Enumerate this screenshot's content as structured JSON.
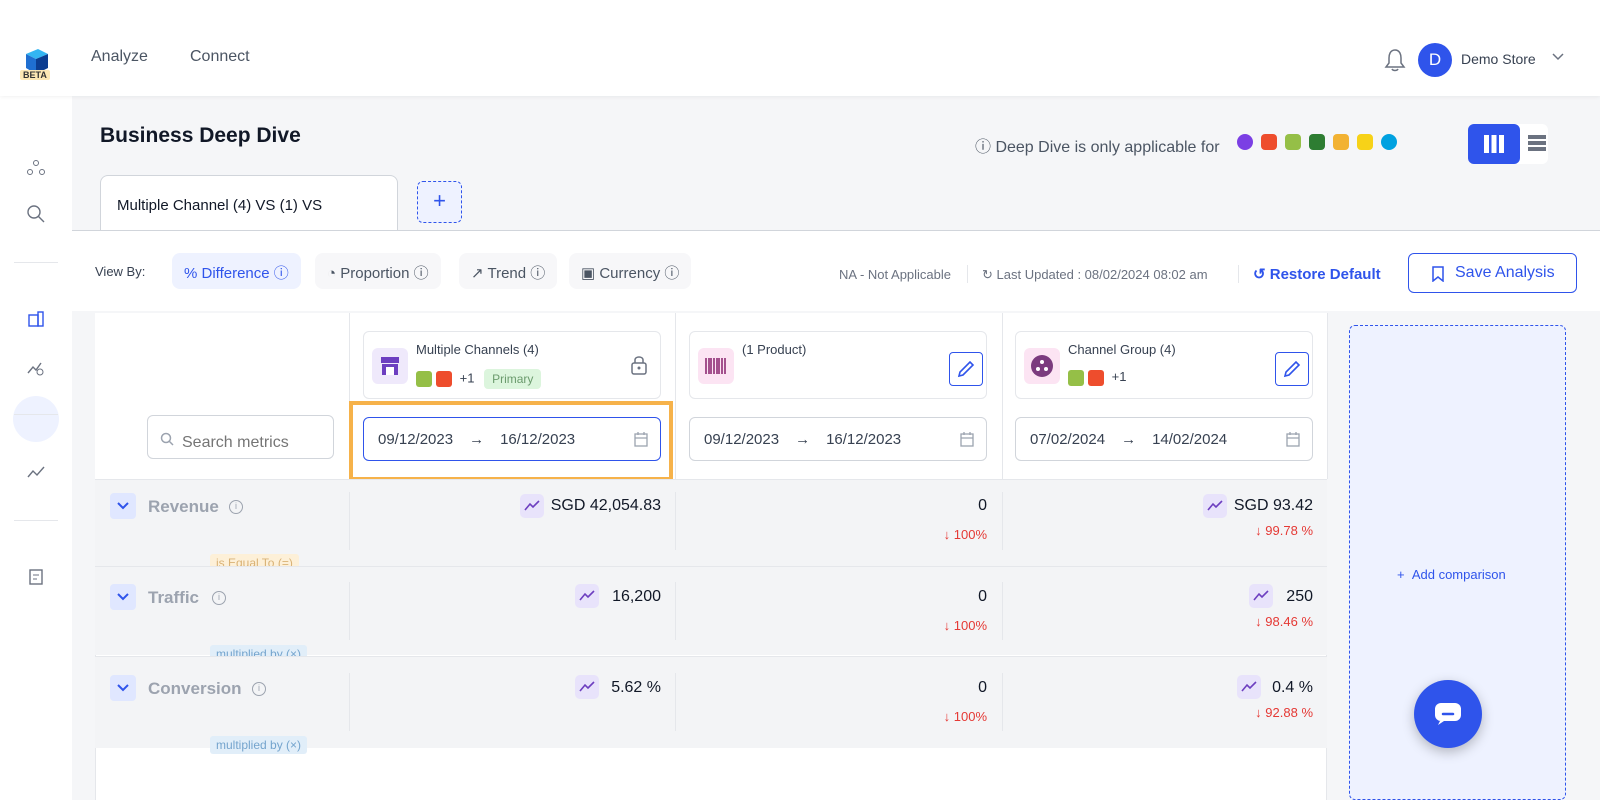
{
  "header": {
    "beta": "BETA",
    "nav": [
      "Analyze",
      "Connect"
    ],
    "avatar_initial": "D",
    "store_name": "Demo Store"
  },
  "page": {
    "title": "Business Deep Dive",
    "deep_dive_note": "Deep Dive is only applicable for",
    "platform_colors": [
      "#7b3fe4",
      "#ee4d2d",
      "#95bf47",
      "#2e7d32",
      "#f2b233",
      "#f7d218",
      "#00a1e0"
    ]
  },
  "tabs": {
    "active": "Multiple Channel (4) VS (1) VS",
    "add_symbol": "+"
  },
  "toolbar": {
    "view_by": "View By:",
    "pills": [
      "% Difference",
      "Proportion",
      "Trend",
      "Currency"
    ],
    "na_note": "NA - Not Applicable",
    "last_updated": "Last Updated : 08/02/2024 08:02 am",
    "restore": "Restore Default",
    "save": "Save Analysis"
  },
  "search": {
    "placeholder": "Search metrics"
  },
  "columns": [
    {
      "name": "Multiple Channels (4)",
      "more": "+1",
      "badge": "Primary",
      "start": "09/12/2023",
      "end": "16/12/2023",
      "arrow": "→"
    },
    {
      "name": "(1 Product)",
      "start": "09/12/2023",
      "end": "16/12/2023",
      "arrow": "→"
    },
    {
      "name": "Channel Group (4)",
      "more": "+1",
      "start": "07/02/2024",
      "end": "14/02/2024",
      "arrow": "→"
    }
  ],
  "metrics": [
    {
      "label": "Revenue",
      "values": [
        "SGD 42,054.83",
        "0",
        "SGD 93.42"
      ],
      "changes": [
        "",
        "100%",
        "99.78 %"
      ],
      "operator": "is Equal To (=)"
    },
    {
      "label": "Traffic",
      "values": [
        "16,200",
        "0",
        "250"
      ],
      "changes": [
        "",
        "100%",
        "98.46 %"
      ],
      "operator": "multiplied by (×)"
    },
    {
      "label": "Conversion",
      "values": [
        "5.62 %",
        "0",
        "0.4 %"
      ],
      "changes": [
        "",
        "100%",
        "92.88 %"
      ],
      "operator": "multiplied by (×)"
    }
  ],
  "add_comparison": "Add comparison",
  "colors": {
    "accent": "#2f54eb",
    "negative": "#e53935",
    "highlight": "#f6b24a"
  }
}
